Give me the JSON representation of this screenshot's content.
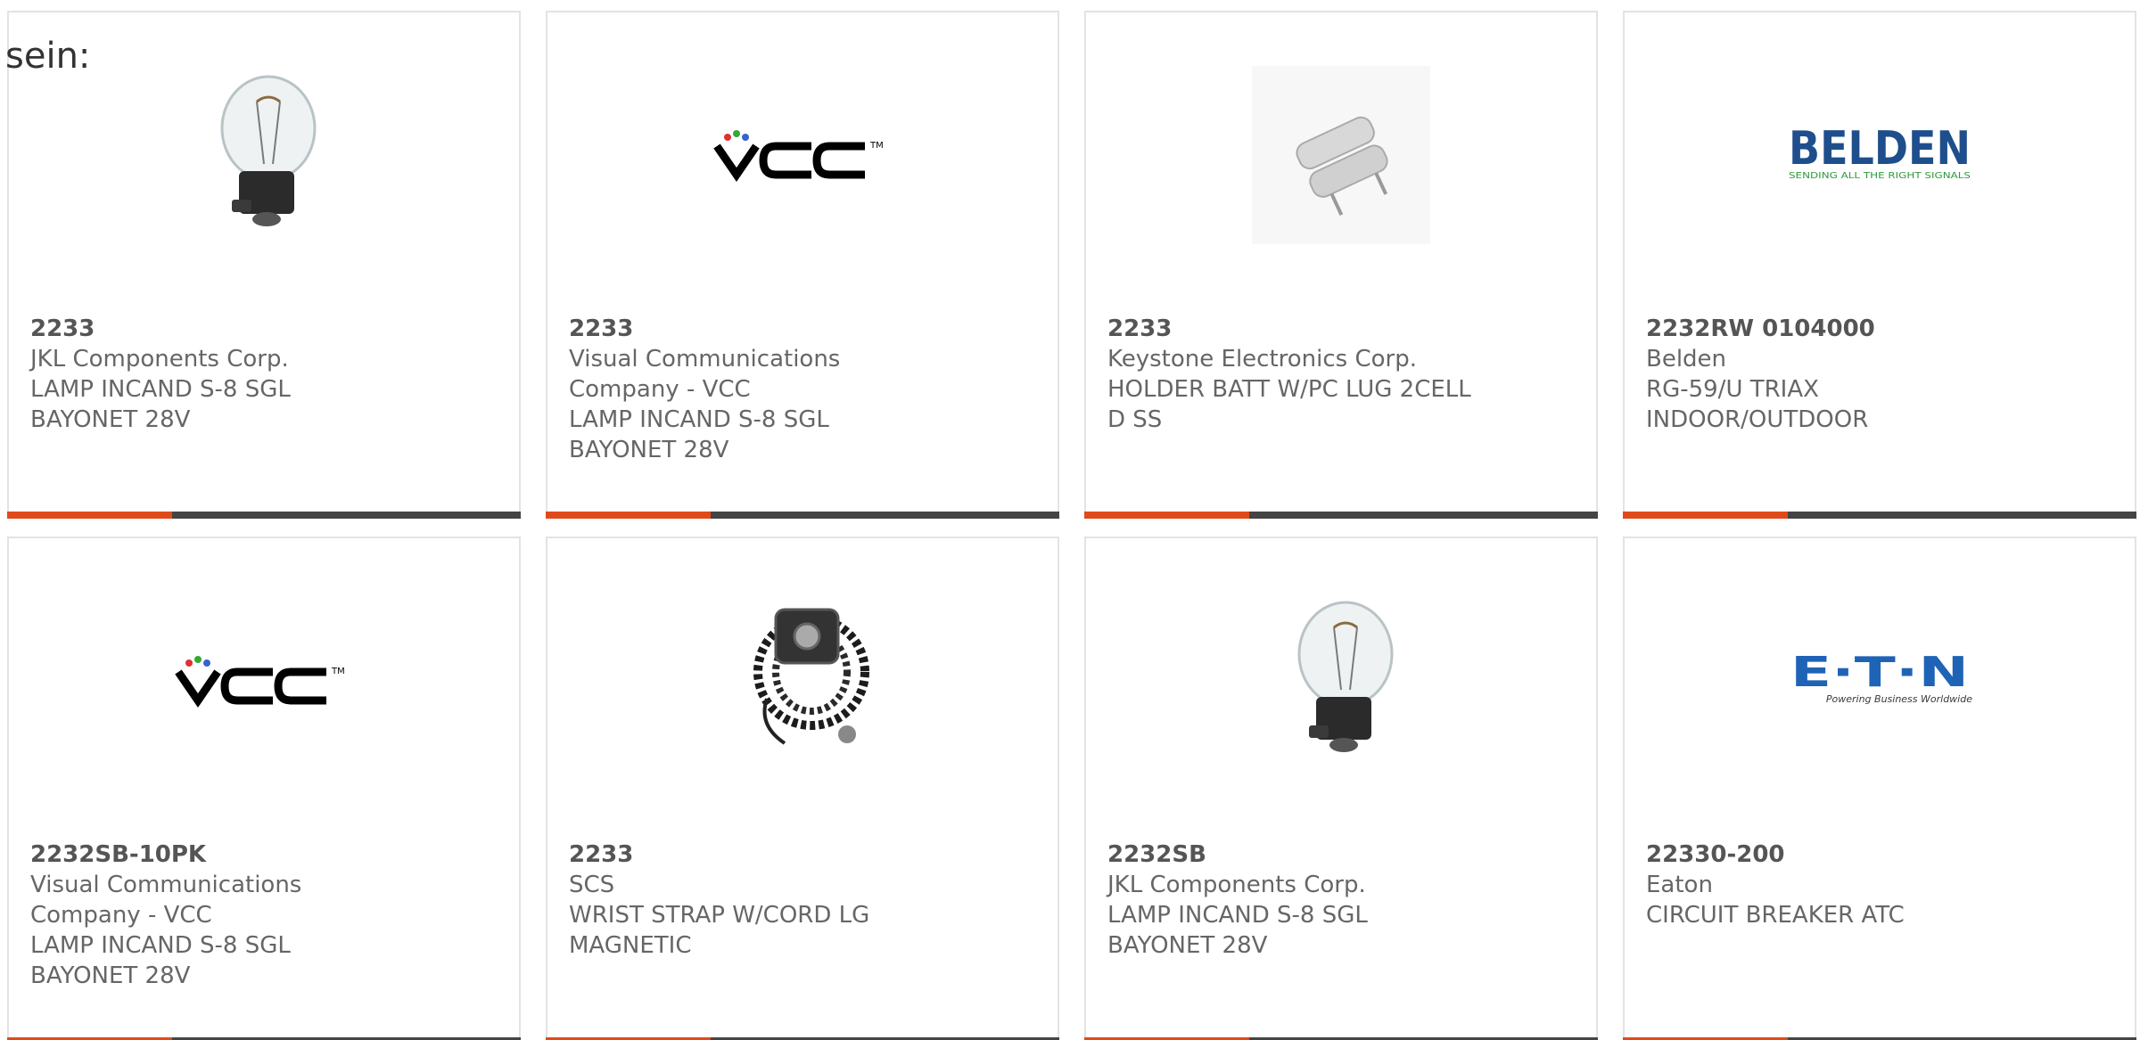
{
  "intro_text": "sein:",
  "colors": {
    "accent": "#e04a1a",
    "bar": "#444444",
    "border": "#e3e3e3",
    "text": "#666666"
  },
  "products": [
    {
      "part": "2233",
      "manufacturer": "JKL Components Corp.",
      "description": "LAMP INCAND S-8 SGL BAYONET 28V",
      "image": "lamp-bulb"
    },
    {
      "part": "2233",
      "manufacturer": "Visual Communications Company - VCC",
      "description": "LAMP INCAND S-8 SGL BAYONET 28V",
      "image": "vcc-logo"
    },
    {
      "part": "2233",
      "manufacturer": "Keystone Electronics Corp.",
      "description": "HOLDER BATT W/PC LUG 2CELL D SS",
      "image": "battery-holder"
    },
    {
      "part": "2232RW 0104000",
      "manufacturer": "Belden",
      "description": "RG-59/U TRIAX INDOOR/OUTDOOR",
      "image": "belden-logo"
    },
    {
      "part": "2232SB-10PK",
      "manufacturer": "Visual Communications Company - VCC",
      "description": "LAMP INCAND S-8 SGL BAYONET 28V",
      "image": "vcc-logo"
    },
    {
      "part": "2233",
      "manufacturer": "SCS",
      "description": "WRIST STRAP W/CORD LG MAGNETIC",
      "image": "wrist-strap"
    },
    {
      "part": "2232SB",
      "manufacturer": "JKL Components Corp.",
      "description": "LAMP INCAND S-8 SGL BAYONET 28V",
      "image": "lamp-bulb"
    },
    {
      "part": "22330-200",
      "manufacturer": "Eaton",
      "description": "CIRCUIT BREAKER ATC",
      "image": "eaton-logo"
    }
  ],
  "logos": {
    "belden": {
      "name": "BELDEN",
      "tagline": "SENDING ALL THE RIGHT SIGNALS"
    },
    "eaton": {
      "name": "E·T·N",
      "tagline": "Powering Business Worldwide"
    },
    "vcc": {
      "name": "VCC"
    }
  }
}
